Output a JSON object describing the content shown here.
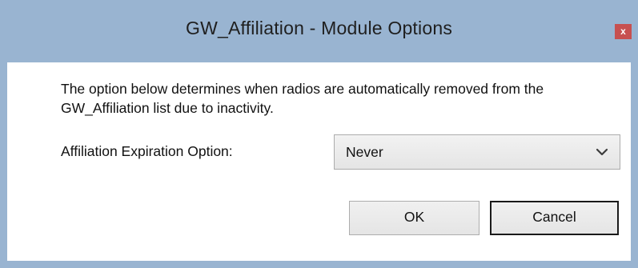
{
  "window": {
    "title": "GW_Affiliation - Module Options",
    "close_glyph": "x"
  },
  "content": {
    "message": "The option below determines when radios are automatically removed from the GW_Affiliation list due to inactivity.",
    "expiration_label": "Affiliation Expiration Option:",
    "expiration_select": {
      "selected": "Never",
      "dropdown_icon": "chevron-down-icon"
    }
  },
  "buttons": {
    "ok_label": "OK",
    "cancel_label": "Cancel"
  },
  "colors": {
    "frame": "#99b4d1",
    "close_button": "#c75050",
    "client_background": "#ffffff"
  }
}
